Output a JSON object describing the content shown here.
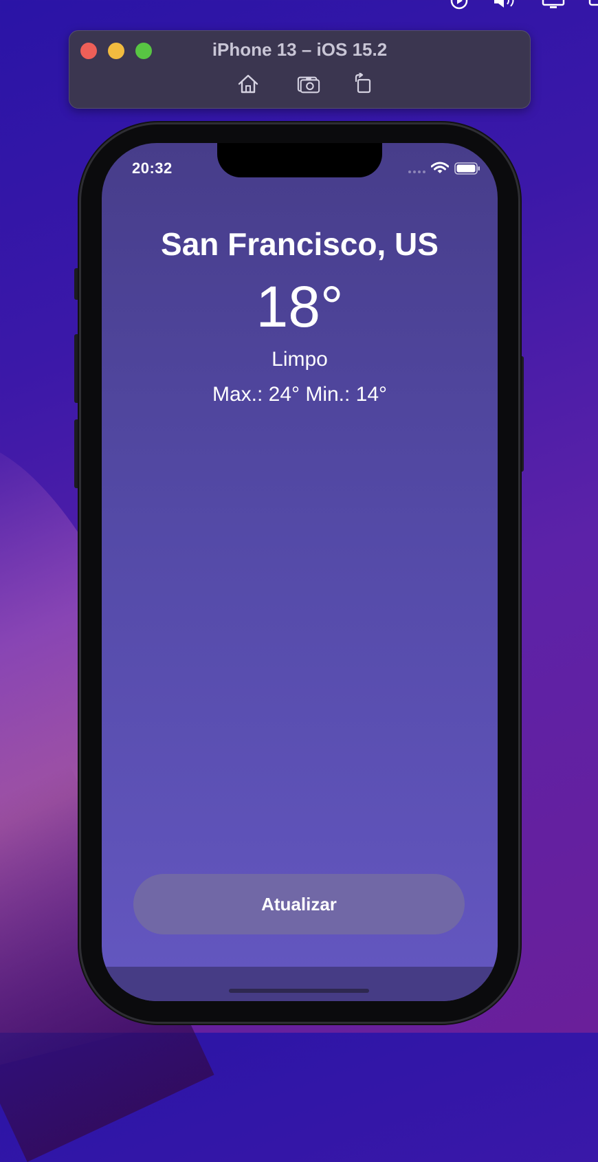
{
  "simulator": {
    "title": "iPhone 13 – iOS 15.2",
    "toolbar_icons": [
      "home-icon",
      "screenshot-icon",
      "rotate-icon"
    ]
  },
  "status_bar": {
    "time": "20:32",
    "icons": [
      "wifi-icon",
      "battery-icon"
    ]
  },
  "weather": {
    "city": "San Francisco, US",
    "temperature": "18°",
    "condition": "Limpo",
    "min_max": "Max.: 24° Min.: 14°"
  },
  "actions": {
    "refresh_label": "Atualizar"
  },
  "colors": {
    "screen_top": "#473d8a",
    "screen_bottom": "#6457c1",
    "button_bg": "#7168a6",
    "close": "#ee5f58",
    "minimize": "#f2bb3f",
    "maximize": "#58c543"
  }
}
